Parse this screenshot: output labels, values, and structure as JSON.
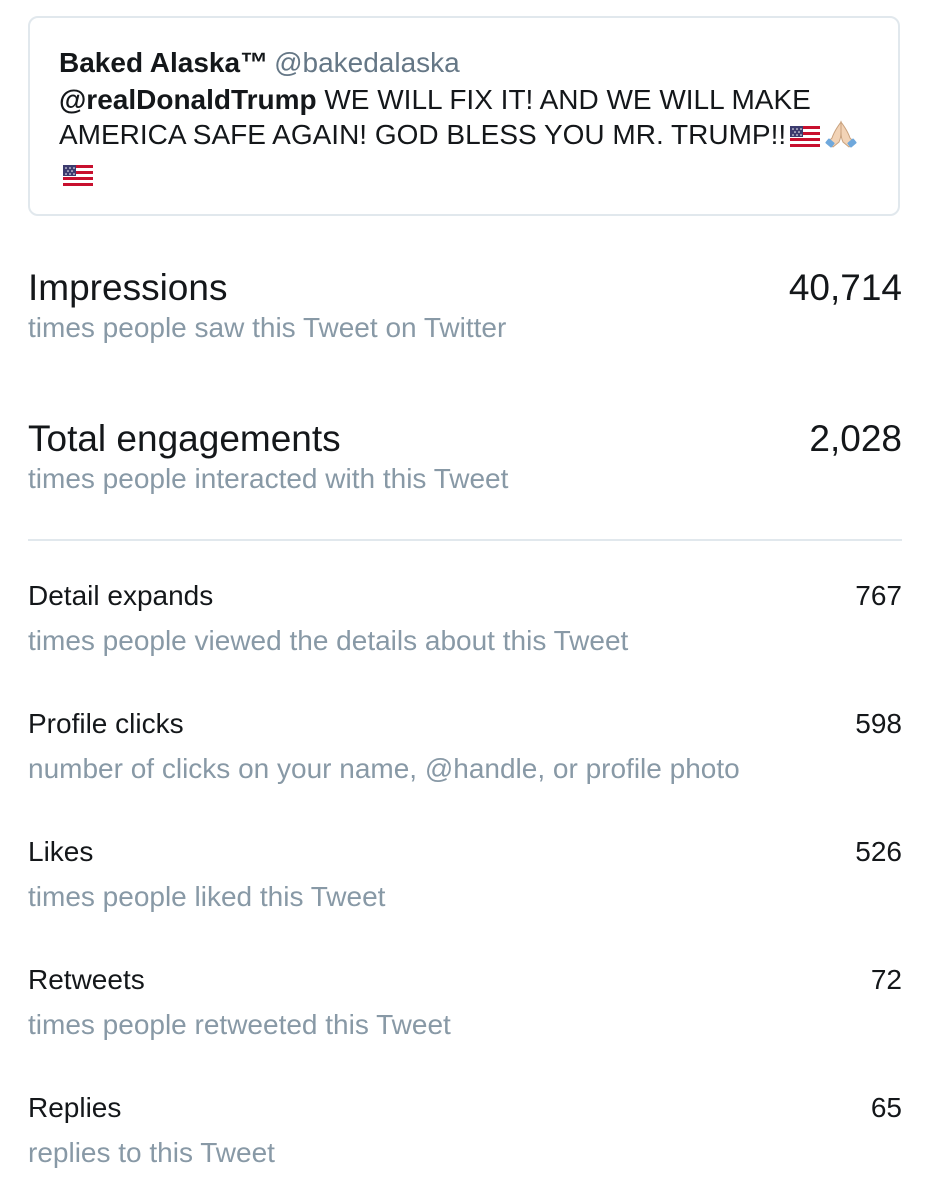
{
  "tweet": {
    "author_name": "Baked Alaska™",
    "author_handle": "@bakedalaska",
    "mention": "@realDonaldTrump",
    "text": " WE WILL FIX IT! AND WE WILL MAKE AMERICA SAFE AGAIN! GOD BLESS YOU MR. TRUMP!!",
    "emojis": [
      "us-flag-icon",
      "folded-hands-icon",
      "us-flag-icon"
    ]
  },
  "metrics_primary": [
    {
      "label": "Impressions",
      "value": "40,714",
      "description": "times people saw this Tweet on Twitter"
    },
    {
      "label": "Total engagements",
      "value": "2,028",
      "description": "times people interacted with this Tweet"
    }
  ],
  "metrics_detail": [
    {
      "label": "Detail expands",
      "value": "767",
      "description": "times people viewed the details about this Tweet"
    },
    {
      "label": "Profile clicks",
      "value": "598",
      "description": "number of clicks on your name, @handle, or profile photo"
    },
    {
      "label": "Likes",
      "value": "526",
      "description": "times people liked this Tweet"
    },
    {
      "label": "Retweets",
      "value": "72",
      "description": "times people retweeted this Tweet"
    },
    {
      "label": "Replies",
      "value": "65",
      "description": "replies to this Tweet"
    }
  ],
  "colors": {
    "primary_text": "#14171a",
    "secondary_text": "#8899a6",
    "handle_text": "#657786",
    "border": "#e1e8ed"
  }
}
